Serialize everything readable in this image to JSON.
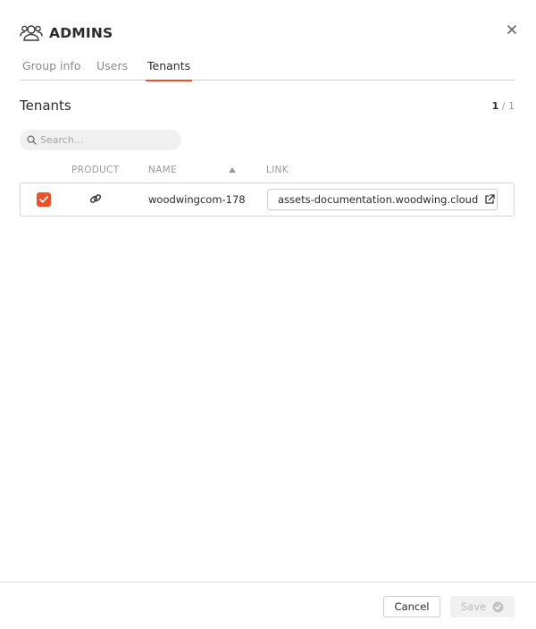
{
  "dialog": {
    "title": "ADMINS",
    "icon": "user-group-icon"
  },
  "tabs": [
    {
      "label": "Group info",
      "active": false
    },
    {
      "label": "Users",
      "active": false
    },
    {
      "label": "Tenants",
      "active": true
    }
  ],
  "section": {
    "title": "Tenants",
    "page_current": "1",
    "page_total": "/ 1"
  },
  "search": {
    "placeholder": "Search...",
    "value": ""
  },
  "table": {
    "columns": [
      "PRODUCT",
      "NAME",
      "LINK"
    ],
    "sorted_column": "NAME",
    "sort_direction": "ascending",
    "rows": [
      {
        "checked": true,
        "product_icon": "link-chain-icon",
        "name": "woodwingcom-178",
        "link": "assets-documentation.woodwing.cloud",
        "link_icon": "external-link-icon"
      }
    ]
  },
  "footer": {
    "cancel_label": "Cancel",
    "save_label": "Save",
    "save_enabled": false
  },
  "colors": {
    "accent": "#e8532b",
    "text": "#2b2b2b",
    "muted": "#9a9a9a"
  }
}
